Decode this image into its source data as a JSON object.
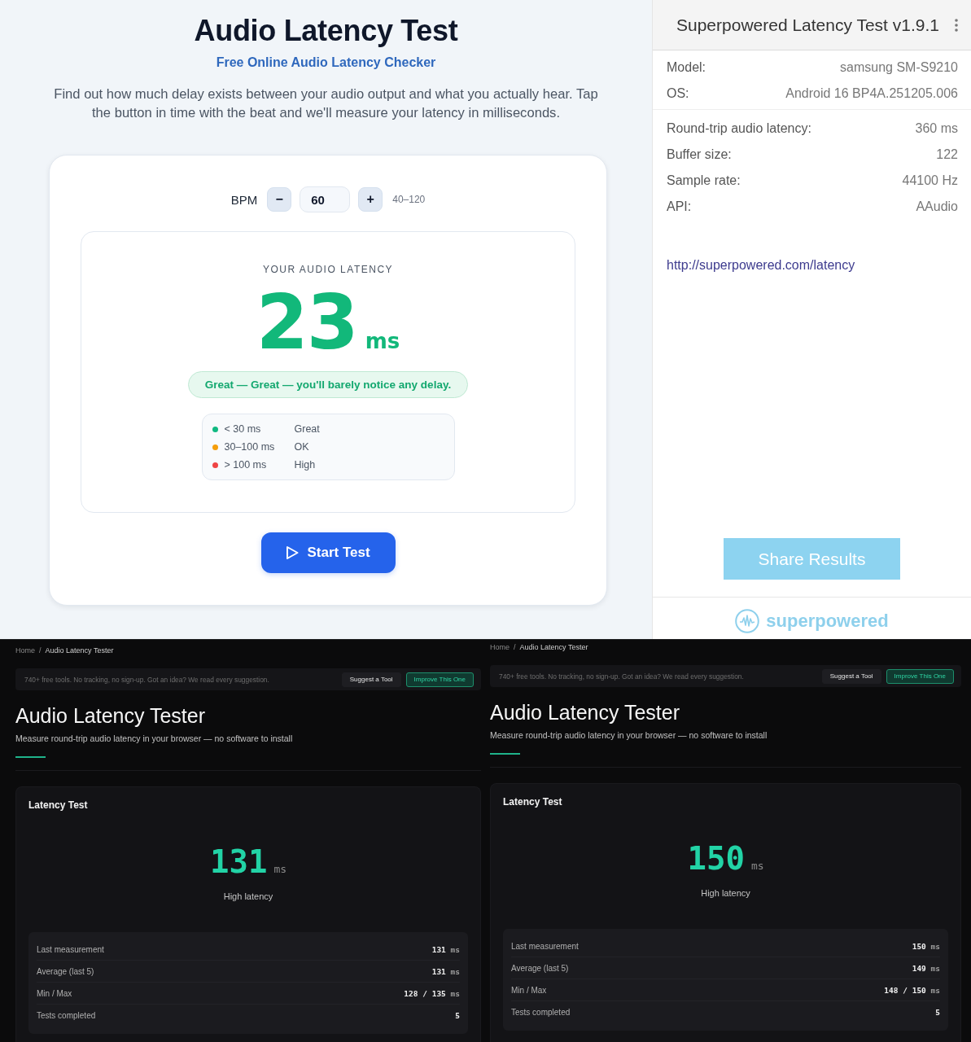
{
  "latency_checker": {
    "title": "Audio Latency Test",
    "subtitle": "Free Online Audio Latency Checker",
    "description": "Find out how much delay exists between your audio output and what you actually hear. Tap the button in time with the beat and we'll measure your latency in milliseconds.",
    "bpm": {
      "label": "BPM",
      "decrease": "−",
      "value": "60",
      "increase": "+",
      "range": "40–120"
    },
    "result": {
      "heading": "YOUR AUDIO LATENCY",
      "value": "23",
      "unit": "ms",
      "verdict": "Great — Great — you'll barely notice any delay."
    },
    "legend": [
      {
        "range": "< 30 ms",
        "label": "Great",
        "color": "#10b981"
      },
      {
        "range": "30–100 ms",
        "label": "OK",
        "color": "#f59e0b"
      },
      {
        "range": "> 100 ms",
        "label": "High",
        "color": "#ef4444"
      }
    ],
    "start_button": "Start Test"
  },
  "superpowered_app": {
    "title": "Superpowered Latency Test v1.9.1",
    "device_info": [
      {
        "label": "Model:",
        "value": "samsung SM-S9210"
      },
      {
        "label": "OS:",
        "value": "Android 16 BP4A.251205.006"
      }
    ],
    "test_results": [
      {
        "label": "Round-trip audio latency:",
        "value": "360 ms"
      },
      {
        "label": "Buffer size:",
        "value": "122"
      },
      {
        "label": "Sample rate:",
        "value": "44100 Hz"
      },
      {
        "label": "API:",
        "value": "AAudio"
      }
    ],
    "link": "http://superpowered.com/latency",
    "share_button": "Share Results",
    "brand": "superpowered"
  },
  "tester_pages": [
    {
      "breadcrumb": [
        {
          "label": "Home",
          "current": false
        },
        {
          "label": "Audio Latency Tester",
          "current": true
        }
      ],
      "separator": "/",
      "notice": "740+ free tools. No tracking, no sign-up. Got an idea? We read every suggestion.",
      "buttons": [
        {
          "label": "Suggest a Tool",
          "kind": "secondary"
        },
        {
          "label": "Improve This One",
          "kind": "primary"
        }
      ],
      "title": "Audio Latency Tester",
      "subtitle": "Measure round-trip audio latency in your browser — no software to install",
      "card_title": "Latency Test",
      "latency": "131",
      "unit": "ms",
      "status": "High latency",
      "stats": [
        {
          "label": "Last measurement",
          "value": "131",
          "unit": "ms"
        },
        {
          "label": "Average (last 5)",
          "value": "131",
          "unit": "ms"
        },
        {
          "label": "Min / Max",
          "value": "128 / 135",
          "unit": "ms"
        },
        {
          "label": "Tests completed",
          "value": "5"
        }
      ]
    },
    {
      "breadcrumb": [
        {
          "label": "Home",
          "current": false
        },
        {
          "label": "Audio Latency Tester",
          "current": true
        }
      ],
      "separator": "/",
      "notice": "740+ free tools. No tracking, no sign-up. Got an idea? We read every suggestion.",
      "buttons": [
        {
          "label": "Suggest a Tool",
          "kind": "secondary"
        },
        {
          "label": "Improve This One",
          "kind": "primary"
        }
      ],
      "title": "Audio Latency Tester",
      "subtitle": "Measure round-trip audio latency in your browser — no software to install",
      "card_title": "Latency Test",
      "latency": "150",
      "unit": "ms",
      "status": "High latency",
      "stats": [
        {
          "label": "Last measurement",
          "value": "150",
          "unit": "ms"
        },
        {
          "label": "Average (last 5)",
          "value": "149",
          "unit": "ms"
        },
        {
          "label": "Min / Max",
          "value": "148 / 150",
          "unit": "ms"
        },
        {
          "label": "Tests completed",
          "value": "5"
        }
      ]
    }
  ]
}
